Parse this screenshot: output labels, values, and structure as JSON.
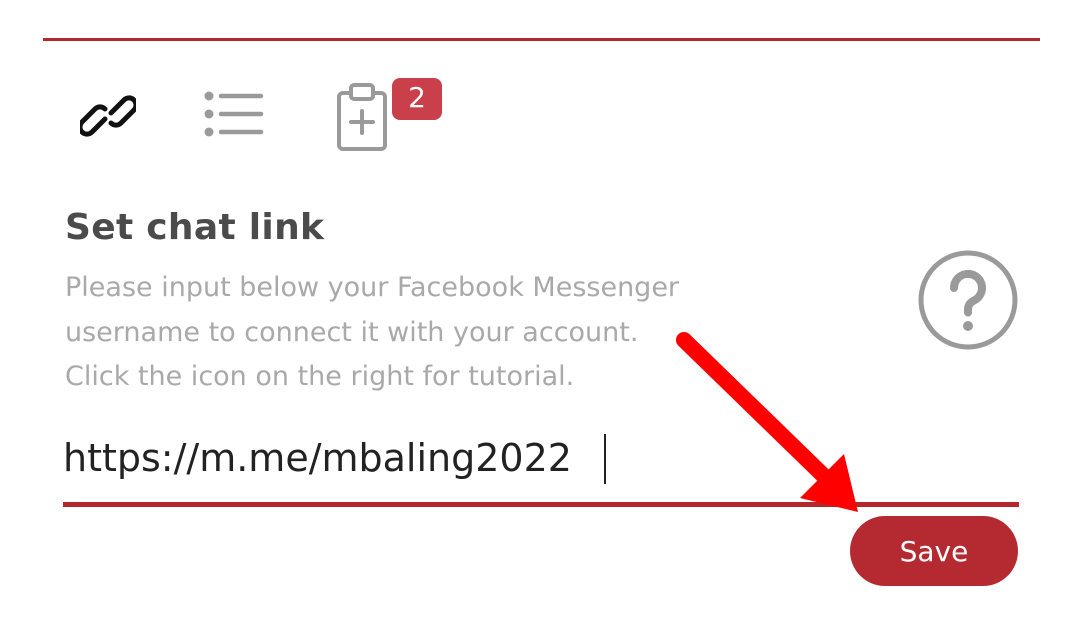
{
  "tabs": [
    {
      "icon": "link-icon",
      "active": true
    },
    {
      "icon": "list-icon",
      "active": false
    },
    {
      "icon": "clipboard-add-icon",
      "active": false,
      "badge": "2"
    }
  ],
  "form": {
    "title": "Set chat link",
    "description": [
      "Please input below your Facebook Messenger",
      "username to connect it with your account.",
      "Click the icon on the right for tutorial."
    ],
    "help_icon": "question-circle-icon",
    "input_value": "https://m.me/mbaling2022",
    "save_label": "Save"
  },
  "colors": {
    "accent": "#b5262d",
    "badge": "#c9404a",
    "muted_text": "#a9a9a9",
    "title_text": "#4b4b4b",
    "annotation_arrow": "#ff0000"
  },
  "annotation": {
    "arrow_icon": "red-arrow-annotation"
  }
}
